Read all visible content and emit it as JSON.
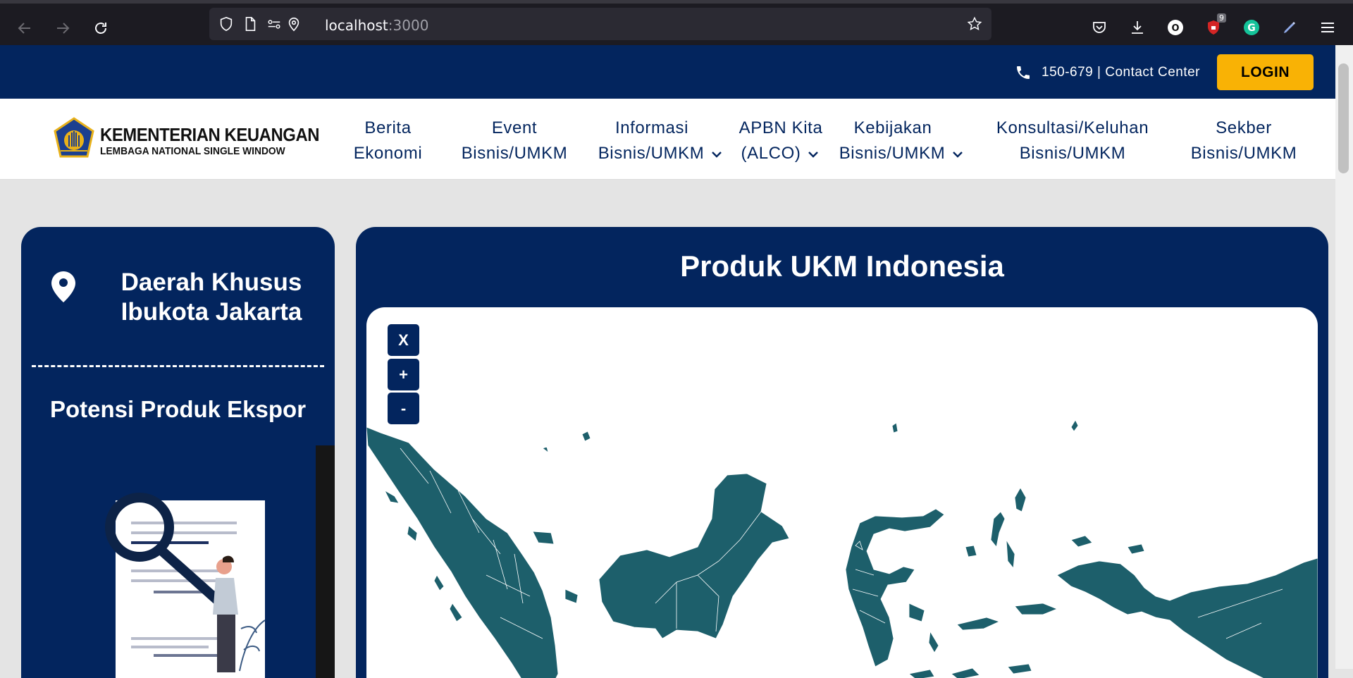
{
  "browser": {
    "url_host": "localhost",
    "url_port": ":3000",
    "extension_badge": "9",
    "profile_initial": "O",
    "grammarly_initial": "G"
  },
  "topbar": {
    "contact_text": "150-679 | Contact Center",
    "login_label": "LOGIN"
  },
  "header": {
    "logo_line1": "KEMENTERIAN KEUANGAN",
    "logo_line2": "LEMBAGA NATIONAL SINGLE WINDOW",
    "menu": [
      {
        "line1": "Berita",
        "line2": "Ekonomi",
        "dropdown": false
      },
      {
        "line1": "Event",
        "line2": "Bisnis/UMKM",
        "dropdown": false
      },
      {
        "line1": "Informasi",
        "line2": "Bisnis/UMKM",
        "dropdown": true
      },
      {
        "line1": "APBN Kita",
        "line2": "(ALCO)",
        "dropdown": true
      },
      {
        "line1": "Kebijakan",
        "line2": "Bisnis/UMKM",
        "dropdown": true
      },
      {
        "line1": "Konsultasi/Keluhan",
        "line2": "Bisnis/UMKM",
        "dropdown": false
      },
      {
        "line1": "Sekber",
        "line2": "Bisnis/UMKM",
        "dropdown": false
      }
    ]
  },
  "sidebar": {
    "region_line1": "Daerah Khusus",
    "region_line2": "Ibukota Jakarta",
    "section_title": "Potensi Produk Ekspor"
  },
  "map": {
    "title": "Produk UKM Indonesia",
    "controls": {
      "close": "X",
      "zoom_in": "+",
      "zoom_out": "-"
    }
  },
  "colors": {
    "brand_navy": "#03255e",
    "accent_yellow": "#f9b205",
    "map_fill": "#1d5f6b",
    "page_bg": "#e4e4e4"
  }
}
